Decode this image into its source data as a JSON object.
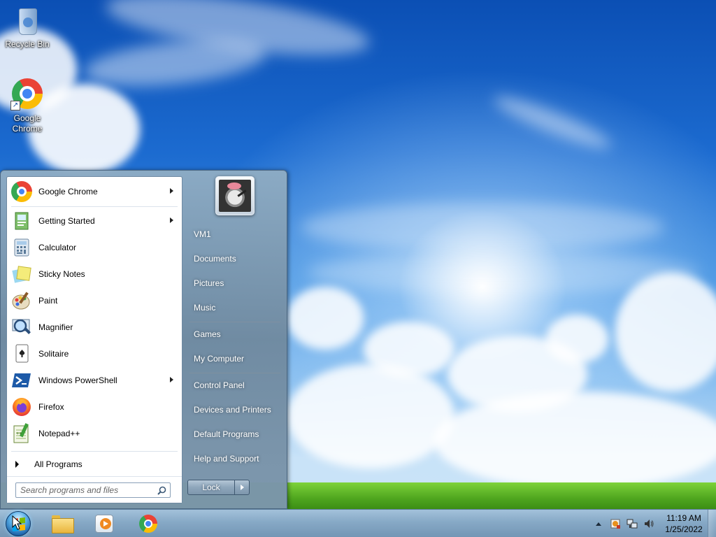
{
  "desktop": {
    "icons": [
      {
        "label": "Recycle Bin"
      },
      {
        "label": "Google Chrome"
      }
    ]
  },
  "start_menu": {
    "programs": [
      {
        "label": "Google Chrome",
        "has_submenu": true
      },
      {
        "label": "Getting Started",
        "has_submenu": true
      },
      {
        "label": "Calculator",
        "has_submenu": false
      },
      {
        "label": "Sticky Notes",
        "has_submenu": false
      },
      {
        "label": "Paint",
        "has_submenu": false
      },
      {
        "label": "Magnifier",
        "has_submenu": false
      },
      {
        "label": "Solitaire",
        "has_submenu": false
      },
      {
        "label": "Windows PowerShell",
        "has_submenu": true
      },
      {
        "label": "Firefox",
        "has_submenu": false
      },
      {
        "label": "Notepad++",
        "has_submenu": false
      }
    ],
    "all_programs_label": "All Programs",
    "search": {
      "placeholder": "Search programs and files",
      "value": ""
    },
    "right_items": {
      "user": "VM1",
      "documents": "Documents",
      "pictures": "Pictures",
      "music": "Music",
      "games": "Games",
      "my_computer": "My Computer",
      "control_panel": "Control Panel",
      "devices_printers": "Devices and Printers",
      "default_programs": "Default Programs",
      "help_support": "Help and Support"
    },
    "lock_label": "Lock"
  },
  "taskbar": {
    "pinned": [
      "file-explorer-icon",
      "media-player-icon",
      "chrome-icon"
    ],
    "clock": {
      "time": "11:19 AM",
      "date": "1/25/2022"
    }
  }
}
